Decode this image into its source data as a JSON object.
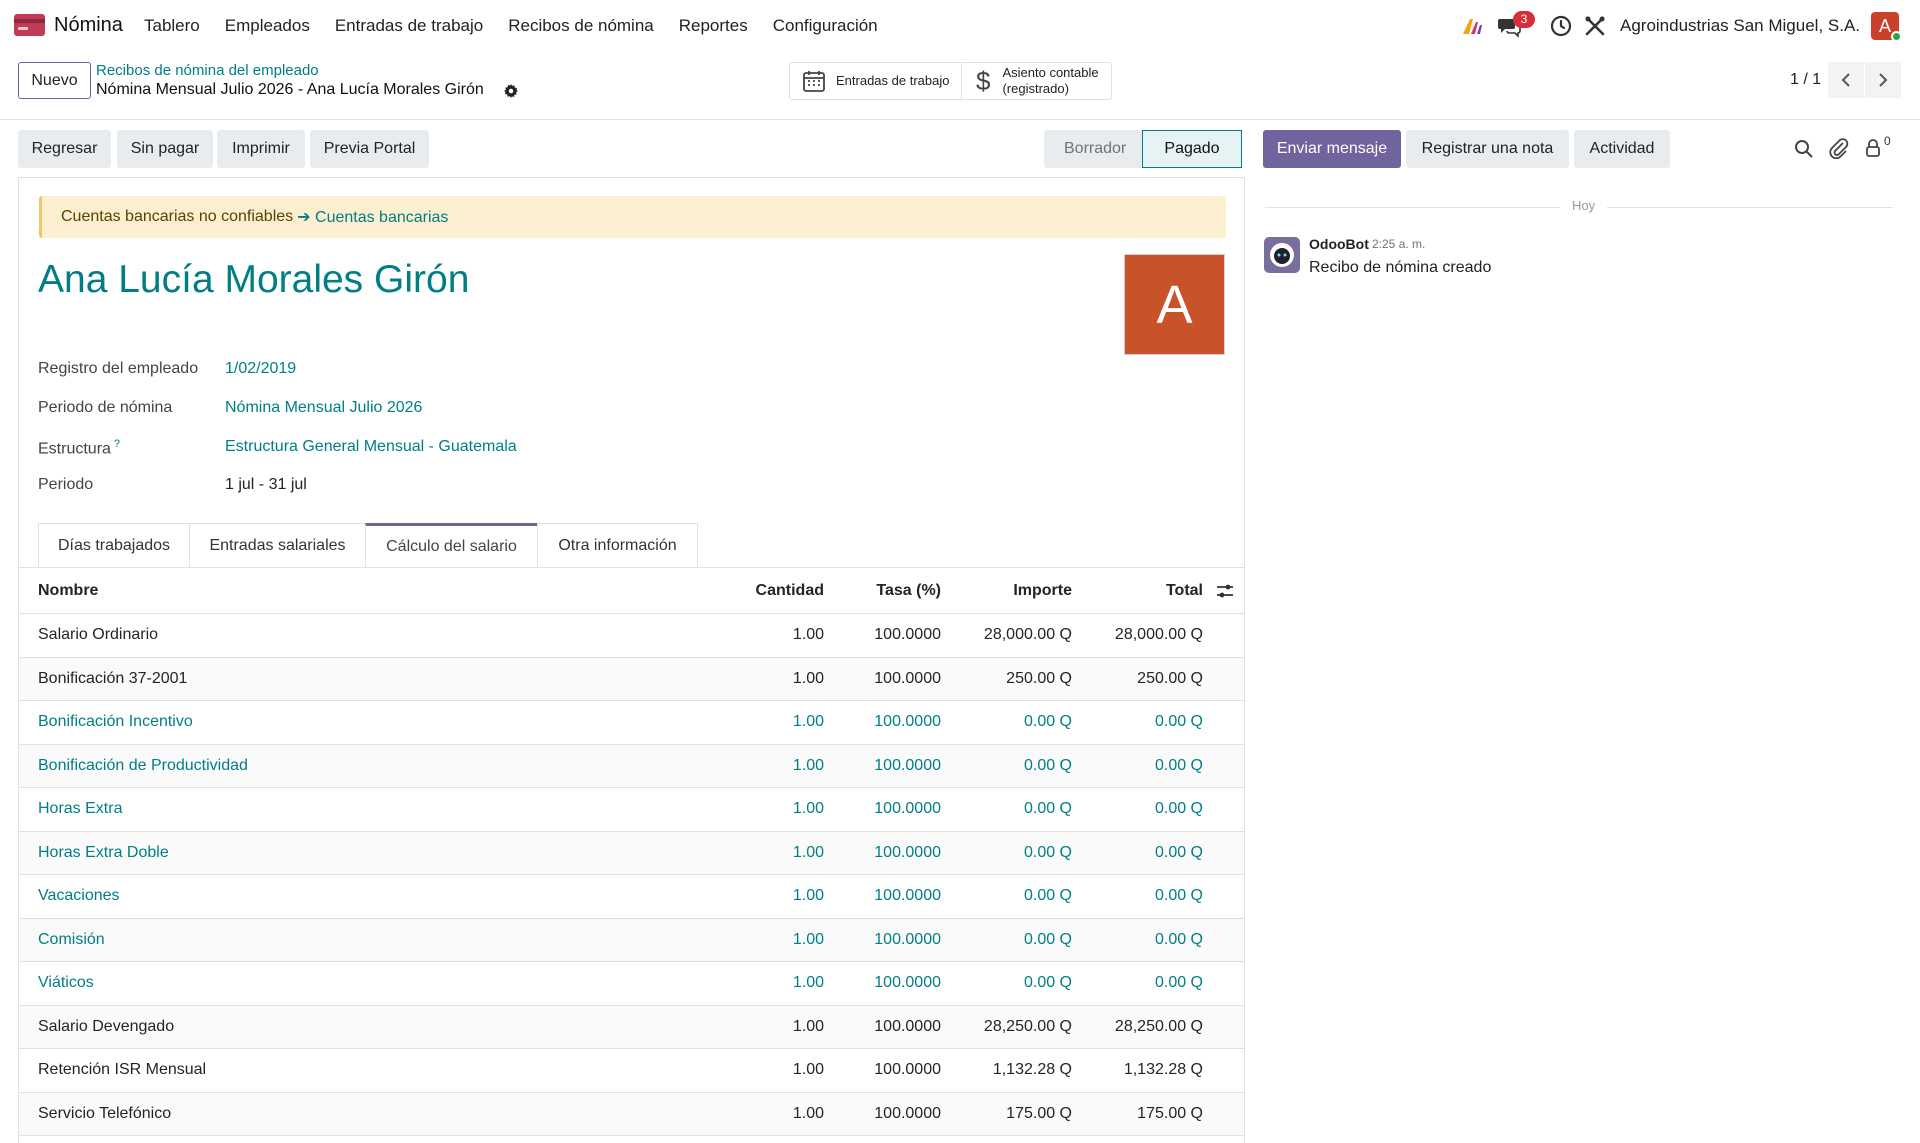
{
  "navbar": {
    "app_name": "Nómina",
    "menu": [
      "Tablero",
      "Empleados",
      "Entradas de trabajo",
      "Recibos de nómina",
      "Reportes",
      "Configuración"
    ],
    "messages_badge": "3",
    "company": "Agroindustrias San Miguel, S.A.",
    "user_initial": "A"
  },
  "control_panel": {
    "new_label": "Nuevo",
    "breadcrumb_parent": "Recibos de nómina del empleado",
    "record_title": "Nómina Mensual Julio 2026 - Ana Lucía Morales Girón",
    "smart_work_entries": "Entradas de trabajo",
    "smart_journal_line1": "Asiento contable",
    "smart_journal_line2": "(registrado)",
    "pager": "1 / 1"
  },
  "actions": {
    "back": "Regresar",
    "unpaid": "Sin pagar",
    "print": "Imprimir",
    "portal_preview": "Previa Portal",
    "status_draft": "Borrador",
    "status_paid": "Pagado"
  },
  "chatter": {
    "send_message": "Enviar mensaje",
    "log_note": "Registrar una nota",
    "activity": "Actividad",
    "followers_count": "0",
    "day_separator": "Hoy",
    "author": "OdooBot",
    "time": "2:25 a. m.",
    "message": "Recibo de nómina creado"
  },
  "form": {
    "alert_text": "Cuentas bancarias no confiables",
    "alert_link": "Cuentas bancarias",
    "employee_name": "Ana Lucía Morales Girón",
    "avatar_initial": "A",
    "fields": [
      {
        "label": "Registro del empleado",
        "value": "1/02/2019"
      },
      {
        "label": "Periodo de nómina",
        "value": "Nómina Mensual Julio 2026"
      },
      {
        "label": "Estructura",
        "value": "Estructura General Mensual - Guatemala"
      },
      {
        "label": "Periodo",
        "value": "1 jul - 31 jul"
      }
    ],
    "help_mark": "?",
    "tabs": [
      "Días trabajados",
      "Entradas salariales",
      "Cálculo del salario",
      "Otra información"
    ]
  },
  "lines_table": {
    "headers": {
      "name": "Nombre",
      "qty": "Cantidad",
      "rate": "Tasa (%)",
      "amount": "Importe",
      "total": "Total"
    },
    "rows": [
      {
        "name": "Salario Ordinario",
        "qty": "1.00",
        "rate": "100.0000",
        "amount": "28,000.00 Q",
        "total": "28,000.00 Q"
      },
      {
        "name": "Bonificación 37-2001",
        "qty": "1.00",
        "rate": "100.0000",
        "amount": "250.00 Q",
        "total": "250.00 Q"
      },
      {
        "name": "Bonificación Incentivo",
        "qty": "1.00",
        "rate": "100.0000",
        "amount": "0.00 Q",
        "total": "0.00 Q"
      },
      {
        "name": "Bonificación de Productividad",
        "qty": "1.00",
        "rate": "100.0000",
        "amount": "0.00 Q",
        "total": "0.00 Q"
      },
      {
        "name": "Horas Extra",
        "qty": "1.00",
        "rate": "100.0000",
        "amount": "0.00 Q",
        "total": "0.00 Q"
      },
      {
        "name": "Horas Extra Doble",
        "qty": "1.00",
        "rate": "100.0000",
        "amount": "0.00 Q",
        "total": "0.00 Q"
      },
      {
        "name": "Vacaciones",
        "qty": "1.00",
        "rate": "100.0000",
        "amount": "0.00 Q",
        "total": "0.00 Q"
      },
      {
        "name": "Comisión",
        "qty": "1.00",
        "rate": "100.0000",
        "amount": "0.00 Q",
        "total": "0.00 Q"
      },
      {
        "name": "Viáticos",
        "qty": "1.00",
        "rate": "100.0000",
        "amount": "0.00 Q",
        "total": "0.00 Q"
      },
      {
        "name": "Salario Devengado",
        "qty": "1.00",
        "rate": "100.0000",
        "amount": "28,250.00 Q",
        "total": "28,250.00 Q"
      },
      {
        "name": "Retención ISR Mensual",
        "qty": "1.00",
        "rate": "100.0000",
        "amount": "1,132.28 Q",
        "total": "1,132.28 Q"
      },
      {
        "name": "Servicio Telefónico",
        "qty": "1.00",
        "rate": "100.0000",
        "amount": "175.00 Q",
        "total": "175.00 Q"
      }
    ]
  },
  "colors": {
    "brand": "#71639e",
    "link": "#017e84",
    "alert_bg": "#fcefd0"
  }
}
